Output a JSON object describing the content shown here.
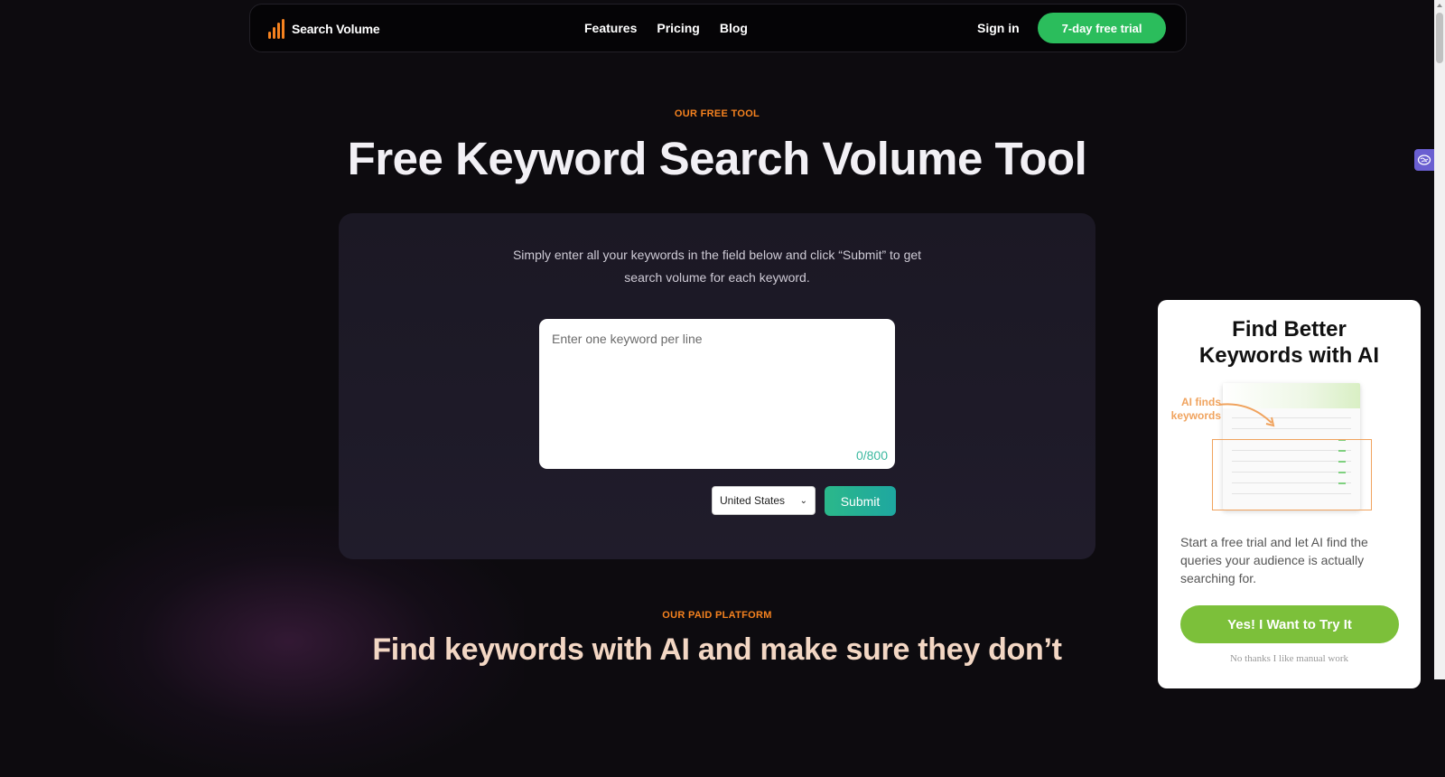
{
  "nav": {
    "logo_text": "Search Volume",
    "links": [
      "Features",
      "Pricing",
      "Blog"
    ],
    "signin_label": "Sign in",
    "trial_label": "7-day free trial"
  },
  "hero": {
    "eyebrow": "OUR FREE TOOL",
    "title": "Free Keyword Search Volume Tool"
  },
  "tool": {
    "description_line1": "Simply enter all your keywords in the field below and click “Submit” to get",
    "description_line2": "search volume for each keyword.",
    "keyword_placeholder": "Enter one keyword per line",
    "keyword_value": "",
    "counter": "0/800",
    "country_selected": "United States",
    "submit_label": "Submit"
  },
  "section2": {
    "eyebrow": "OUR PAID PLATFORM",
    "title": "Find keywords with AI and make sure they don’t"
  },
  "popup": {
    "title_line1": "Find Better",
    "title_line2": "Keywords with AI",
    "image_label_line1": "AI finds",
    "image_label_line2": "keywords",
    "description": "Start a free trial and let AI find the queries your audience is actually searching for.",
    "cta_label": "Yes! I Want to Try It",
    "decline_label": "No thanks I like manual work"
  },
  "colors": {
    "accent_orange": "#f5821f",
    "trial_green": "#2bbd5c",
    "submit_teal": "#1ea7a0",
    "cta_green": "#7cc03a",
    "background": "#0d0b0f"
  }
}
